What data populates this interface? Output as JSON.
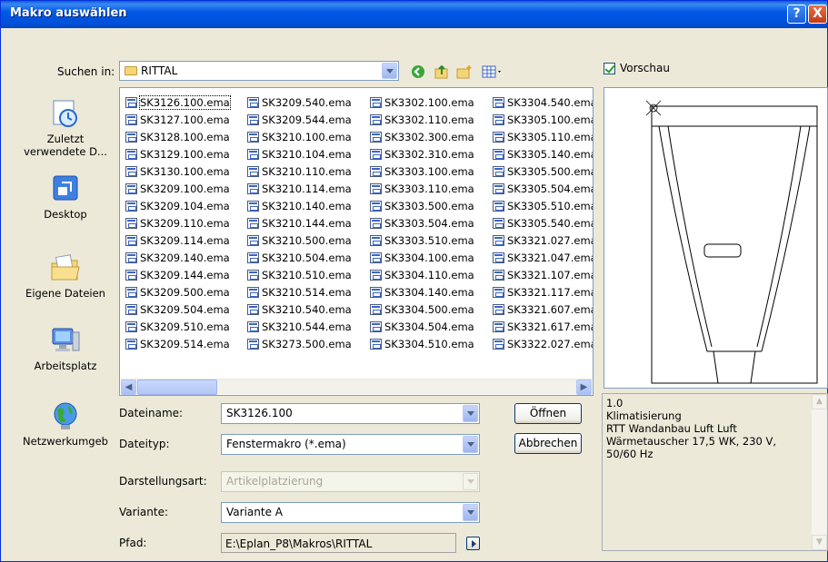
{
  "window": {
    "title": "Makro auswählen",
    "help_label": "?",
    "close_label": "X"
  },
  "lookin": {
    "label": "Suchen in:",
    "folder": "RITTAL"
  },
  "preview_checkbox": {
    "label": "Vorschau"
  },
  "places": [
    {
      "label": "Zuletzt verwendete D...",
      "icon": "recent-documents-icon"
    },
    {
      "label": "Desktop",
      "icon": "desktop-icon"
    },
    {
      "label": "Eigene Dateien",
      "icon": "my-documents-icon"
    },
    {
      "label": "Arbeitsplatz",
      "icon": "my-computer-icon"
    },
    {
      "label": "Netzwerkumgeb",
      "icon": "network-icon"
    }
  ],
  "files": {
    "selected": "SK3126.100.ema",
    "columns": [
      [
        "SK3126.100.ema",
        "SK3127.100.ema",
        "SK3128.100.ema",
        "SK3129.100.ema",
        "SK3130.100.ema",
        "SK3209.100.ema",
        "SK3209.104.ema",
        "SK3209.110.ema",
        "SK3209.114.ema",
        "SK3209.140.ema",
        "SK3209.144.ema",
        "SK3209.500.ema",
        "SK3209.504.ema",
        "SK3209.510.ema",
        "SK3209.514.ema"
      ],
      [
        "SK3209.540.ema",
        "SK3209.544.ema",
        "SK3210.100.ema",
        "SK3210.104.ema",
        "SK3210.110.ema",
        "SK3210.114.ema",
        "SK3210.140.ema",
        "SK3210.144.ema",
        "SK3210.500.ema",
        "SK3210.504.ema",
        "SK3210.510.ema",
        "SK3210.514.ema",
        "SK3210.540.ema",
        "SK3210.544.ema",
        "SK3273.500.ema"
      ],
      [
        "SK3302.100.ema",
        "SK3302.110.ema",
        "SK3302.300.ema",
        "SK3302.310.ema",
        "SK3303.100.ema",
        "SK3303.110.ema",
        "SK3303.500.ema",
        "SK3303.504.ema",
        "SK3303.510.ema",
        "SK3304.100.ema",
        "SK3304.110.ema",
        "SK3304.140.ema",
        "SK3304.500.ema",
        "SK3304.504.ema",
        "SK3304.510.ema"
      ],
      [
        "SK3304.540.ema",
        "SK3305.100.ema",
        "SK3305.110.ema",
        "SK3305.140.ema",
        "SK3305.500.ema",
        "SK3305.504.ema",
        "SK3305.510.ema",
        "SK3305.540.ema",
        "SK3321.027.ema",
        "SK3321.047.ema",
        "SK3321.107.ema",
        "SK3321.117.ema",
        "SK3321.607.ema",
        "SK3321.617.ema",
        "SK3322.027.ema"
      ]
    ]
  },
  "form": {
    "filename_label": "Dateiname:",
    "filename_value": "SK3126.100",
    "filetype_label": "Dateityp:",
    "filetype_value": "Fenstermakro (*.ema)",
    "display_label": "Darstellungsart:",
    "display_value": "Artikelplatzierung",
    "variant_label": "Variante:",
    "variant_value": "Variante A",
    "path_label": "Pfad:",
    "path_value": "E:\\Eplan_P8\\Makros\\RITTAL"
  },
  "buttons": {
    "open": "Öffnen",
    "cancel": "Abbrechen"
  },
  "description": {
    "lines": [
      "1.0",
      "Klimatisierung",
      "RTT Wandanbau Luft Luft",
      "Wärmetauscher 17,5 WK, 230 V,",
      "50/60 Hz"
    ]
  }
}
